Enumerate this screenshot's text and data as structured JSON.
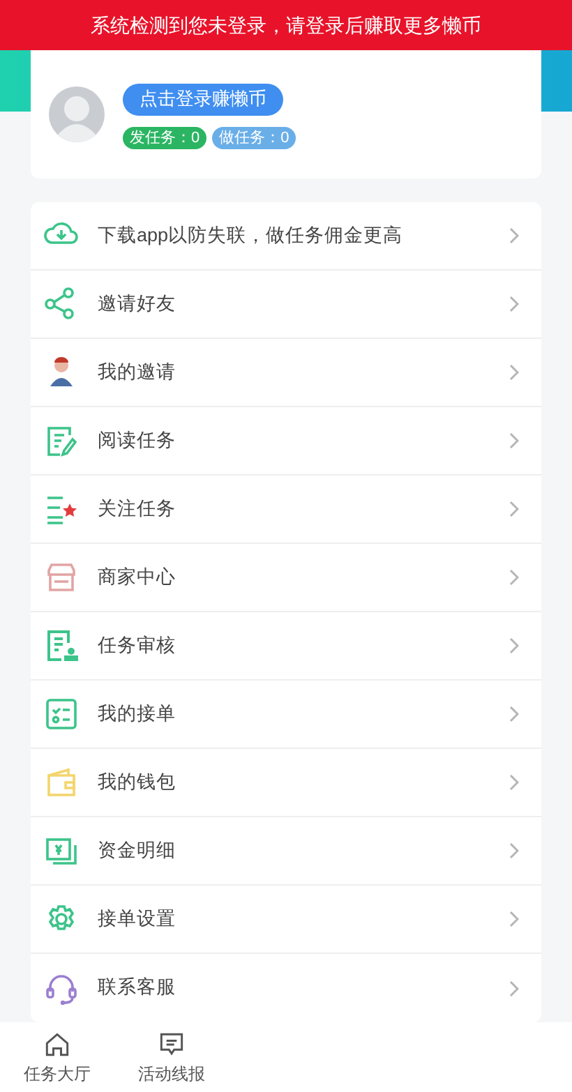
{
  "notice": "系统检测到您未登录，请登录后赚取更多懒币",
  "profile": {
    "login_button": "点击登录赚懒币",
    "badges": [
      {
        "kind": "publish",
        "label": "发任务：0"
      },
      {
        "kind": "do",
        "label": "做任务：0"
      }
    ]
  },
  "menu": [
    {
      "kind": "download",
      "label": "下载app以防失联，做任务佣金更高"
    },
    {
      "kind": "share",
      "label": "邀请好友"
    },
    {
      "kind": "person",
      "label": "我的邀请"
    },
    {
      "kind": "read",
      "label": "阅读任务"
    },
    {
      "kind": "follow",
      "label": "关注任务"
    },
    {
      "kind": "shop",
      "label": "商家中心"
    },
    {
      "kind": "review",
      "label": "任务审核"
    },
    {
      "kind": "orders",
      "label": "我的接单"
    },
    {
      "kind": "wallet",
      "label": "我的钱包"
    },
    {
      "kind": "money",
      "label": "资金明细"
    },
    {
      "kind": "settings",
      "label": "接单设置"
    },
    {
      "kind": "support",
      "label": "联系客服"
    }
  ],
  "tab_bar": [
    {
      "kind": "home",
      "label": "任务大厅"
    },
    {
      "kind": "message",
      "label": "活动线报"
    }
  ]
}
